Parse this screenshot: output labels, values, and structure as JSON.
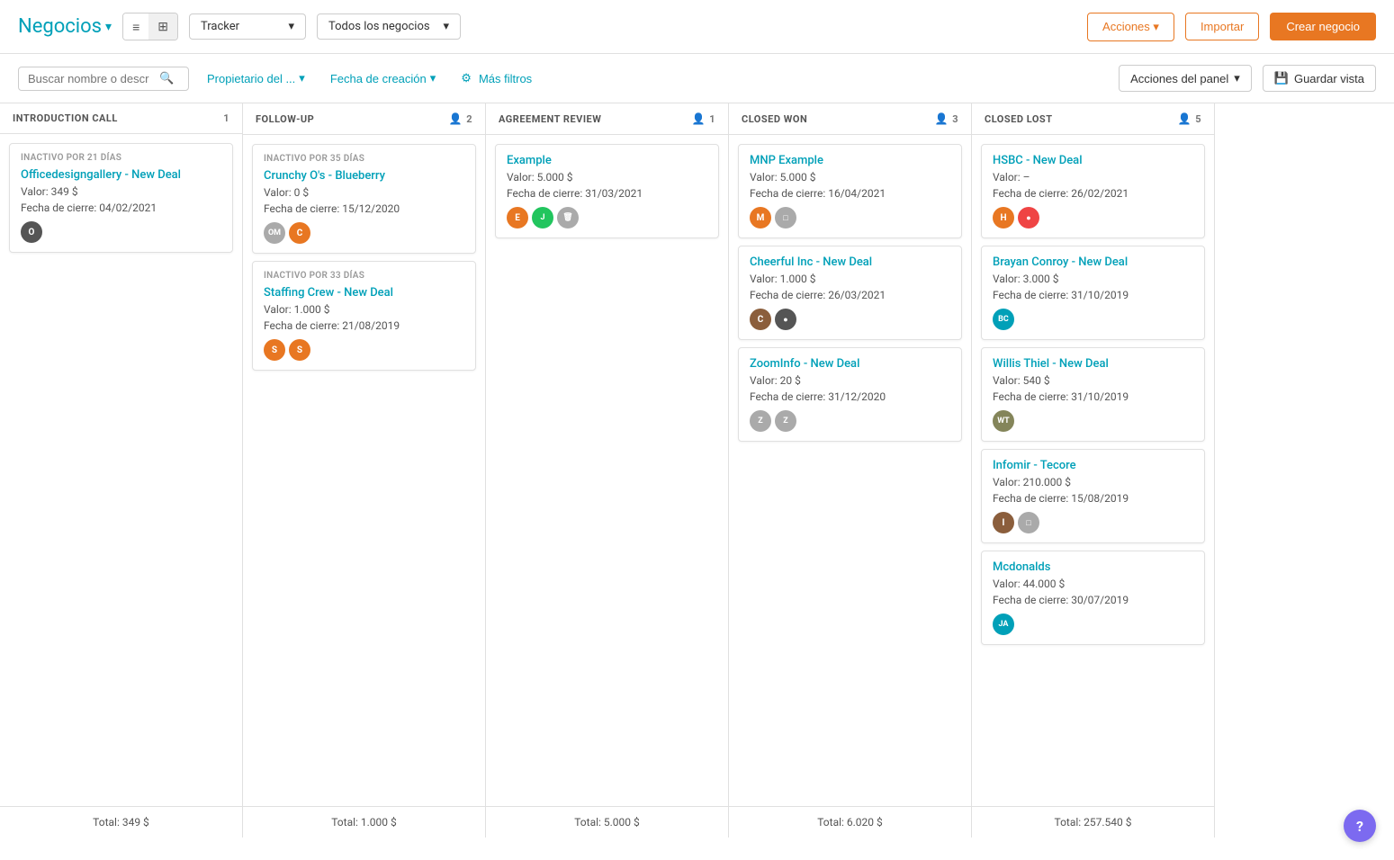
{
  "app": {
    "title": "Negocios",
    "tracker_label": "Tracker",
    "todos_label": "Todos los negocios"
  },
  "toolbar": {
    "acciones_label": "Acciones",
    "importar_label": "Importar",
    "crear_label": "Crear negocio"
  },
  "filters": {
    "search_placeholder": "Buscar nombre o descr",
    "propietario_label": "Propietario del ...",
    "fecha_label": "Fecha de creación",
    "mas_filtros_label": "Más filtros",
    "panel_actions_label": "Acciones del panel",
    "save_view_label": "Guardar vista"
  },
  "columns": [
    {
      "id": "intro_call",
      "title": "INTRODUCTION CALL",
      "count": 1,
      "show_person_icon": false,
      "cards": [
        {
          "inactive_label": "INACTIVO POR 21 DÍAS",
          "title": "Officedesigngallery - New Deal",
          "value": "Valor: 349 $",
          "date": "Fecha de cierre: 04/02/2021",
          "avatars": [
            {
              "initials": "",
              "color": "av-dark",
              "is_img": true,
              "img_char": "O"
            }
          ]
        }
      ],
      "total": "Total: 349 $"
    },
    {
      "id": "follow_up",
      "title": "FOLLOW-UP",
      "count": 2,
      "show_person_icon": true,
      "cards": [
        {
          "inactive_label": "INACTIVO POR 35 DÍAS",
          "title": "Crunchy O's - Blueberry",
          "value": "Valor: 0 $",
          "date": "Fecha de cierre: 15/12/2020",
          "avatars": [
            {
              "initials": "OM",
              "color": "av-gray",
              "is_img": false
            },
            {
              "initials": "",
              "color": "av-orange",
              "is_img": true,
              "img_char": "C"
            }
          ]
        },
        {
          "inactive_label": "INACTIVO POR 33 DÍAS",
          "title": "Staffing Crew - New Deal",
          "value": "Valor: 1.000 $",
          "date": "Fecha de cierre: 21/08/2019",
          "avatars": [
            {
              "initials": "",
              "color": "av-orange",
              "is_img": true,
              "img_char": "S"
            },
            {
              "initials": "",
              "color": "av-orange",
              "is_img": true,
              "img_char": "S"
            }
          ]
        }
      ],
      "total": "Total: 1.000 $"
    },
    {
      "id": "agreement_review",
      "title": "AGREEMENT REVIEW",
      "count": 1,
      "show_person_icon": true,
      "cards": [
        {
          "inactive_label": "",
          "title": "Example",
          "value": "Valor: 5.000 $",
          "date": "Fecha de cierre: 31/03/2021",
          "avatars": [
            {
              "initials": "",
              "color": "av-orange",
              "is_img": true,
              "img_char": "E"
            },
            {
              "initials": "J",
              "color": "av-green",
              "is_img": false
            },
            {
              "initials": "🗑",
              "color": "av-gray",
              "is_img": false
            }
          ]
        }
      ],
      "total": "Total: 5.000 $"
    },
    {
      "id": "closed_won",
      "title": "CLOSED WON",
      "count": 3,
      "show_person_icon": true,
      "cards": [
        {
          "inactive_label": "",
          "title": "MNP Example",
          "value": "Valor: 5.000 $",
          "date": "Fecha de cierre: 16/04/2021",
          "avatars": [
            {
              "initials": "",
              "color": "av-orange",
              "is_img": true,
              "img_char": "M"
            },
            {
              "initials": "□",
              "color": "av-gray",
              "is_img": false
            }
          ]
        },
        {
          "inactive_label": "",
          "title": "Cheerful Inc - New Deal",
          "value": "Valor: 1.000 $",
          "date": "Fecha de cierre: 26/03/2021",
          "avatars": [
            {
              "initials": "",
              "color": "av-brown",
              "is_img": true,
              "img_char": "C"
            },
            {
              "initials": "●",
              "color": "av-dark",
              "is_img": false
            }
          ]
        },
        {
          "inactive_label": "",
          "title": "ZoomInfo - New Deal",
          "value": "Valor: 20 $",
          "date": "Fecha de cierre: 31/12/2020",
          "avatars": [
            {
              "initials": "Z",
              "color": "av-gray",
              "is_img": false
            },
            {
              "initials": "Z",
              "color": "av-gray",
              "is_img": false
            }
          ]
        }
      ],
      "total": "Total: 6.020 $"
    },
    {
      "id": "closed_lost",
      "title": "CLOSED LOST",
      "count": 5,
      "show_person_icon": true,
      "cards": [
        {
          "inactive_label": "",
          "title": "HSBC - New Deal",
          "value": "Valor: –",
          "date": "Fecha de cierre: 26/02/2021",
          "avatars": [
            {
              "initials": "",
              "color": "av-orange",
              "is_img": true,
              "img_char": "H"
            },
            {
              "initials": "●",
              "color": "av-red",
              "is_img": false
            }
          ]
        },
        {
          "inactive_label": "",
          "title": "Brayan Conroy - New Deal",
          "value": "Valor: 3.000 $",
          "date": "Fecha de cierre: 31/10/2019",
          "avatars": [
            {
              "initials": "BC",
              "color": "av-teal",
              "is_img": false
            }
          ]
        },
        {
          "inactive_label": "",
          "title": "Willis Thiel - New Deal",
          "value": "Valor: 540 $",
          "date": "Fecha de cierre: 31/10/2019",
          "avatars": [
            {
              "initials": "WT",
              "color": "av-olive",
              "is_img": false
            }
          ]
        },
        {
          "inactive_label": "",
          "title": "Infomir - Tecore",
          "value": "Valor: 210.000 $",
          "date": "Fecha de cierre: 15/08/2019",
          "avatars": [
            {
              "initials": "",
              "color": "av-brown",
              "is_img": true,
              "img_char": "I"
            },
            {
              "initials": "□",
              "color": "av-gray",
              "is_img": false
            }
          ]
        },
        {
          "inactive_label": "",
          "title": "Mcdonalds",
          "value": "Valor: 44.000 $",
          "date": "Fecha de cierre: 30/07/2019",
          "avatars": [
            {
              "initials": "JA",
              "color": "av-teal",
              "is_img": false
            }
          ]
        }
      ],
      "total": "Total: 257.540 $"
    }
  ],
  "help": "?"
}
